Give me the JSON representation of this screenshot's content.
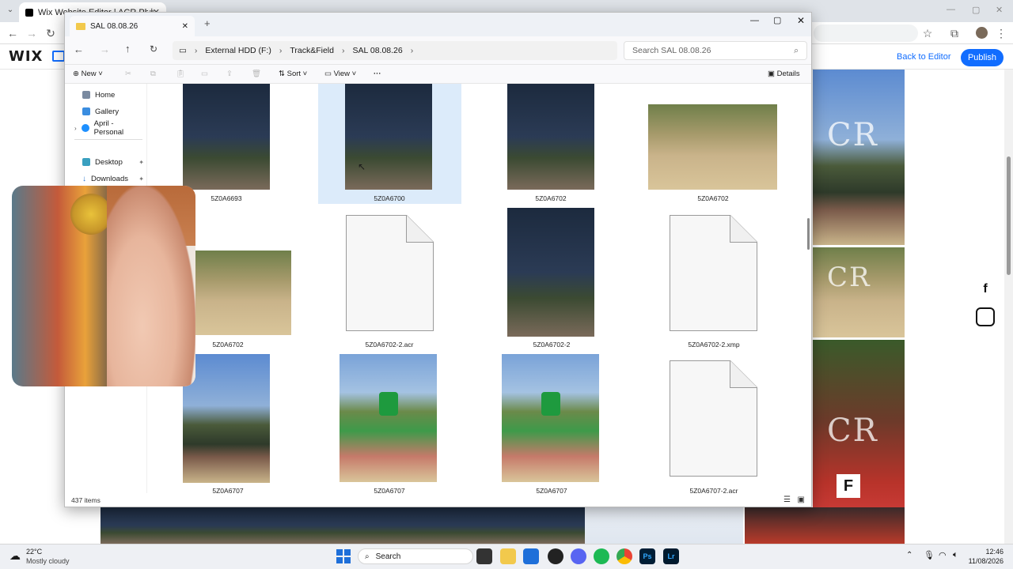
{
  "browser": {
    "tab_title": "Wix Website Editor | ACR Phot",
    "add_tab": "+",
    "back_to_editor": "Back to Editor",
    "publish": "Publish",
    "wix_logo": "WIX"
  },
  "explorer": {
    "tab_title": "SAL 08.08.26",
    "breadcrumb": [
      "External HDD (F:)",
      "Track&Field",
      "SAL 08.08.26"
    ],
    "search_placeholder": "Search SAL 08.08.26",
    "commands": {
      "new": "New",
      "sort": "Sort",
      "view": "View",
      "more": "···",
      "details": "Details"
    },
    "nav": [
      {
        "label": "Home",
        "icon": "home-icon"
      },
      {
        "label": "Gallery",
        "icon": "gallery-icon"
      },
      {
        "label": "April - Personal",
        "icon": "cloud-icon"
      },
      {
        "label": "Desktop",
        "icon": "desktop-icon"
      },
      {
        "label": "Downloads",
        "icon": "download-icon"
      }
    ],
    "files": [
      {
        "name": "5Z0A6693",
        "kind": "photo"
      },
      {
        "name": "5Z0A6700",
        "kind": "photo",
        "selected": true
      },
      {
        "name": "5Z0A6702",
        "kind": "photo"
      },
      {
        "name": "5Z0A6702",
        "kind": "photo-wide"
      },
      {
        "name": "5Z0A6702",
        "kind": "photo-wide"
      },
      {
        "name": "5Z0A6702-2.acr",
        "kind": "file"
      },
      {
        "name": "5Z0A6702-2",
        "kind": "photo"
      },
      {
        "name": "5Z0A6702-2.xmp",
        "kind": "file"
      },
      {
        "name": "5Z0A6707",
        "kind": "photo"
      },
      {
        "name": "5Z0A6707",
        "kind": "photo-green"
      },
      {
        "name": "5Z0A6707",
        "kind": "photo-green"
      },
      {
        "name": "5Z0A6707-2.acr",
        "kind": "file"
      }
    ],
    "status": "437 items"
  },
  "site": {
    "social": [
      "f",
      "ig"
    ]
  },
  "taskbar": {
    "weather_temp": "22°C",
    "weather_desc": "Mostly cloudy",
    "search": "Search",
    "time": "12:46",
    "date": "11/08/2026"
  }
}
